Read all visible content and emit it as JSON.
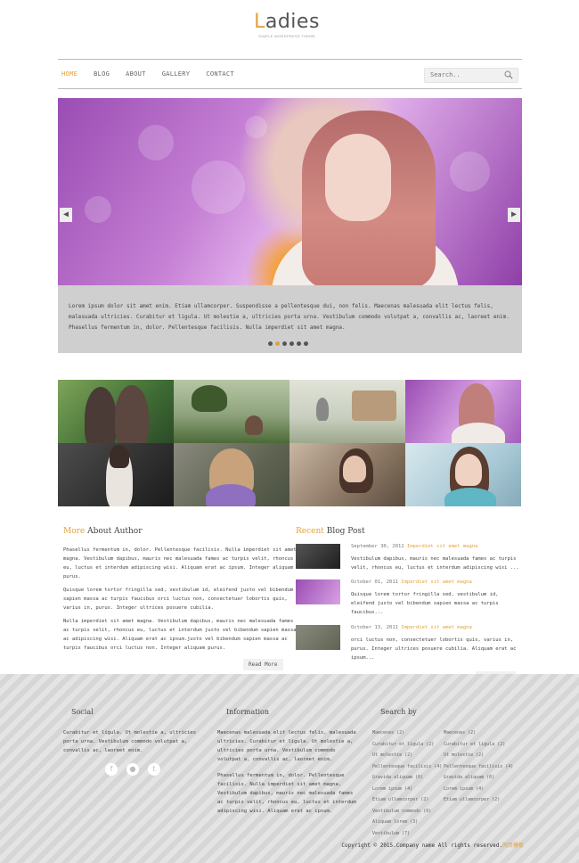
{
  "brand": {
    "title_accent": "L",
    "title_rest": "adies",
    "tagline": "SIMPLE WORDPRESS THEME",
    "accent_color": "#e2a23b"
  },
  "nav": {
    "items": [
      "HOME",
      "BLOG",
      "ABOUT",
      "GALLERY",
      "CONTACT"
    ],
    "active": "HOME"
  },
  "search": {
    "placeholder": "Search.."
  },
  "slider": {
    "caption": "Lorem ipsum dolor sit amet enim. Etiam ullamcorper. Suspendisse a pellentesque dui, non felis. Maecenas malesuada elit lectus felis, malesuada ultricies. Curabitur et ligula. Ut molestie a, ultricies porta urna. Vestibulum commodo volutpat a, convallis ac, laoreet enim. Phasellus fermentum in, dolor. Pellentesque facilisis. Nulla imperdiet sit amet magna.",
    "dots": 6,
    "active_dot": 1,
    "prev_icon": "chevron-left-icon",
    "next_icon": "chevron-right-icon"
  },
  "about": {
    "title_highlight": "More",
    "title_rest": " About Author",
    "paragraphs": [
      "Phasellus fermentum in, dolor. Pellentesque facilisis. Nulla imperdiet sit amet magna. Vestibulum dapibus, mauris nec malesuada fames ac turpis velit, rhoncus eu, luctus et interdum adipiscing wisi. Aliquam erat ac ipsum. Integer aliquam purus.",
      "Quisque lorem tortor fringilla sed, vestibulum id, eleifend justo vel bibendum sapien massa ac turpis faucibus orci luctus non, consectetuer lobortis quis, varius in, purus. Integer ultrices posuere cubilia.",
      "Nulla imperdiet sit amet magna. Vestibulum dapibus, mauris nec malesuada fames ac turpis velit, rhoncus eu, luctus et interdum justo vel bibendum sapien massa ac adipiscing wisi. Aliquam erat ac ipsum.justo vel bibendum sapien massa ac turpis faucibus orci luctus non. Integer aliquam purus."
    ],
    "read_more": "Read More"
  },
  "recent": {
    "title_highlight": "Recent",
    "title_rest": " Blog Post",
    "posts": [
      {
        "date": "September 30, 2011",
        "link": "Imperdiet sit amet magna",
        "text": "Vestibulum dapibus, mauris nec malesuada fames ac turpis velit, rhoncus eu, luctus et interdum adipiscing wisi ..."
      },
      {
        "date": "October 01, 2011",
        "link": "Imperdiet sit amet magna",
        "text": "Quisque lorem tortor fringilla sed, vestibulum id, eleifend justo vel bibendum sapien massa ac turpis faucibus..."
      },
      {
        "date": "October 13, 2011",
        "link": "Imperdiet sit amet magna",
        "text": "orci luctus non, consectetuer lobortis quis, varius in, purus. Integer ultrices posuere cubilia. Aliquam erat ac ipsum..."
      }
    ],
    "read_more": "Read More"
  },
  "footer": {
    "social": {
      "title": "Social",
      "text": "Curabitur et ligula. Ut molestie a, ultricies porta urna. Vestibulum commodo volutpat a, convallis ac, laoreet enim.",
      "icons": [
        "facebook-icon",
        "rss-icon",
        "twitter-icon"
      ],
      "icon_glyphs": [
        "f",
        "●",
        "t"
      ]
    },
    "information": {
      "title": "Information",
      "paragraphs": [
        "Maecenas malesuada elit lectus felis, malesuada ultricies. Curabitur et ligula. Ut molestie a, ultricies porta urna. Vestibulum commodo volutpat a, convallis ac, laoreet enim.",
        "Phasellus fermentum in, dolor. Pellentesque facilisis. Nulla imperdiet sit amet magna. Vestibulum dapibus, mauris nec malesuada fames ac turpis velit, rhoncus eu, luctus et interdum adipiscing wisi. Aliquam erat ac ipsum."
      ]
    },
    "search_by": {
      "title": "Search by",
      "col1": [
        "Maecenas (2)",
        "Curabitur et ligula (2)",
        "Ut molestie (2)",
        "Pellentesque facilisis (4)",
        "Gravida aliquam (6)",
        "Lorem ipsum (4)",
        "Etiam ullamcorper (2)",
        "Vestibulum commodo (6)",
        "Aliquam lorem (3)",
        "Vestibulum (7)"
      ],
      "col2": [
        "Maecenas (2)",
        "Curabitur et ligula (2)",
        "Ut molestie (2)",
        "Pellentesque facilisis (4)",
        "Gravida aliquam (6)",
        "Lorem ipsum (4)",
        "Etiam ullamcorper (2)"
      ]
    },
    "copyright": "Copyright © 2015.Company name All rights reserved.",
    "copyright_link": "网页模板"
  }
}
